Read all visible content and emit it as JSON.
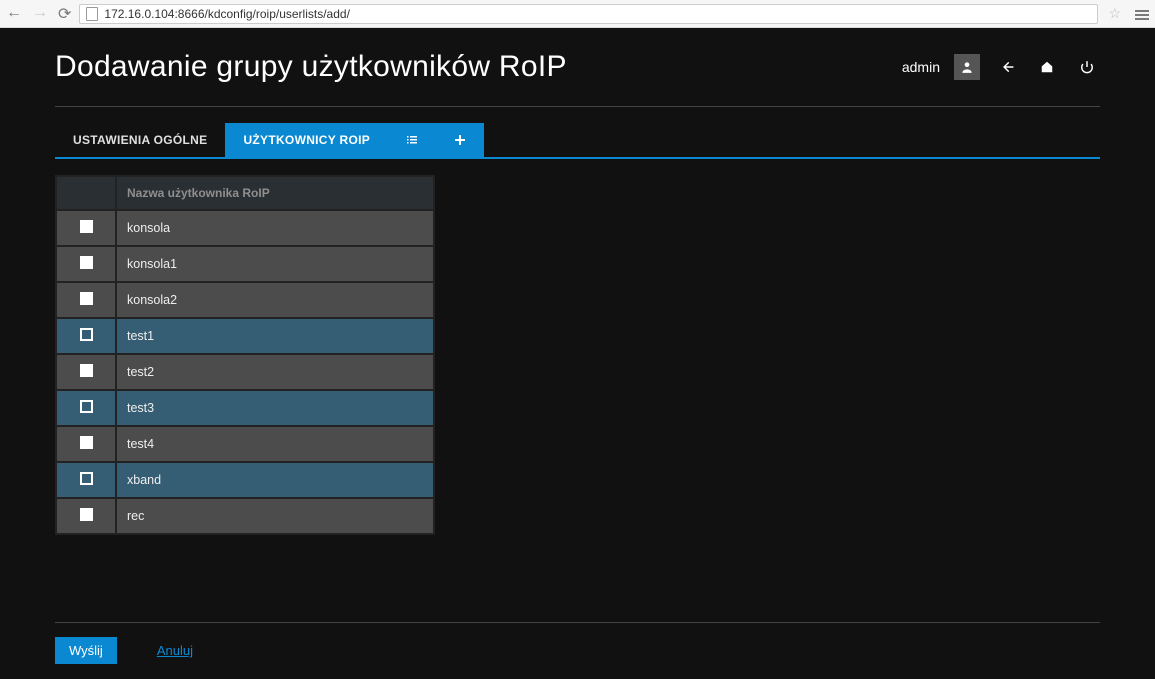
{
  "browser": {
    "url": "172.16.0.104:8666/kdconfig/roip/userlists/add/"
  },
  "header": {
    "title": "Dodawanie grupy użytkowników RoIP",
    "user": "admin"
  },
  "tabs": {
    "general": "USTAWIENIA OGÓLNE",
    "users": "UŻYTKOWNICY ROIP"
  },
  "table": {
    "name_header": "Nazwa użytkownika RoIP",
    "rows": [
      {
        "name": "konsola",
        "selected": false
      },
      {
        "name": "konsola1",
        "selected": false
      },
      {
        "name": "konsola2",
        "selected": false
      },
      {
        "name": "test1",
        "selected": true
      },
      {
        "name": "test2",
        "selected": false
      },
      {
        "name": "test3",
        "selected": true
      },
      {
        "name": "test4",
        "selected": false
      },
      {
        "name": "xband",
        "selected": true
      },
      {
        "name": "rec",
        "selected": false
      }
    ]
  },
  "footer": {
    "submit": "Wyślij",
    "cancel": "Anuluj"
  }
}
